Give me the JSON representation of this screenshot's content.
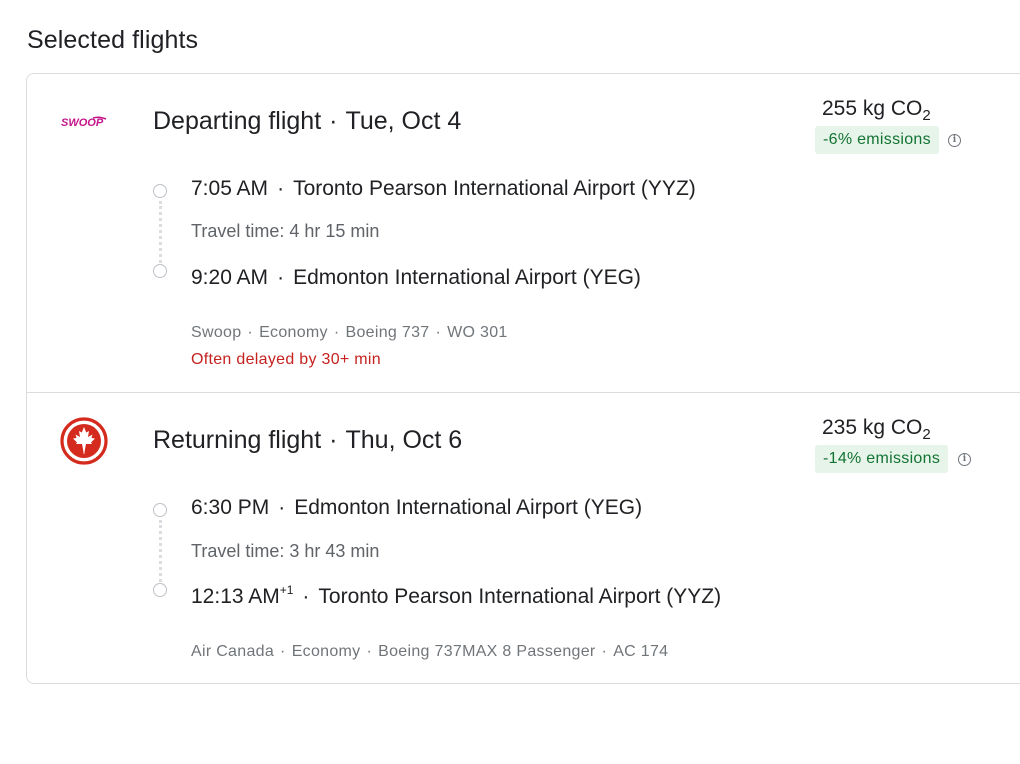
{
  "page": {
    "title": "Selected flights"
  },
  "departing": {
    "airline_logo": "swoop-logo",
    "logo_text": "SWOOP",
    "title": "Departing flight",
    "date": "Tue, Oct 4",
    "co2_value": "255 kg CO",
    "co2_sub": "2",
    "emissions_badge": "-6% emissions",
    "depart_time": "7:05 AM",
    "depart_airport": "Toronto Pearson International Airport (YYZ)",
    "travel_time": "Travel time: 4 hr 15 min",
    "arrive_time": "9:20 AM",
    "arrive_time_sup": "",
    "arrive_airport": "Edmonton International Airport (YEG)",
    "airline": "Swoop",
    "cabin": "Economy",
    "aircraft": "Boeing 737",
    "flight_number": "WO 301",
    "delay_note": "Often delayed by 30+ min"
  },
  "returning": {
    "airline_logo": "air-canada-logo",
    "title": "Returning flight",
    "date": "Thu, Oct 6",
    "co2_value": "235 kg CO",
    "co2_sub": "2",
    "emissions_badge": "-14% emissions",
    "depart_time": "6:30 PM",
    "depart_airport": "Edmonton International Airport (YEG)",
    "travel_time": "Travel time: 3 hr 43 min",
    "arrive_time": "12:13 AM",
    "arrive_time_sup": "+1",
    "arrive_airport": "Toronto Pearson International Airport (YYZ)",
    "airline": "Air Canada",
    "cabin": "Economy",
    "aircraft": "Boeing 737MAX 8 Passenger",
    "flight_number": "AC 174"
  },
  "colors": {
    "emissions_bg": "#e6f4ea",
    "emissions_text": "#137333",
    "delay_text": "#c5221f",
    "swoop_brand": "#c4168a",
    "air_canada_red": "#d52b1e"
  },
  "icons": {
    "info": "info-icon",
    "timeline": "timeline-circle-icon"
  }
}
